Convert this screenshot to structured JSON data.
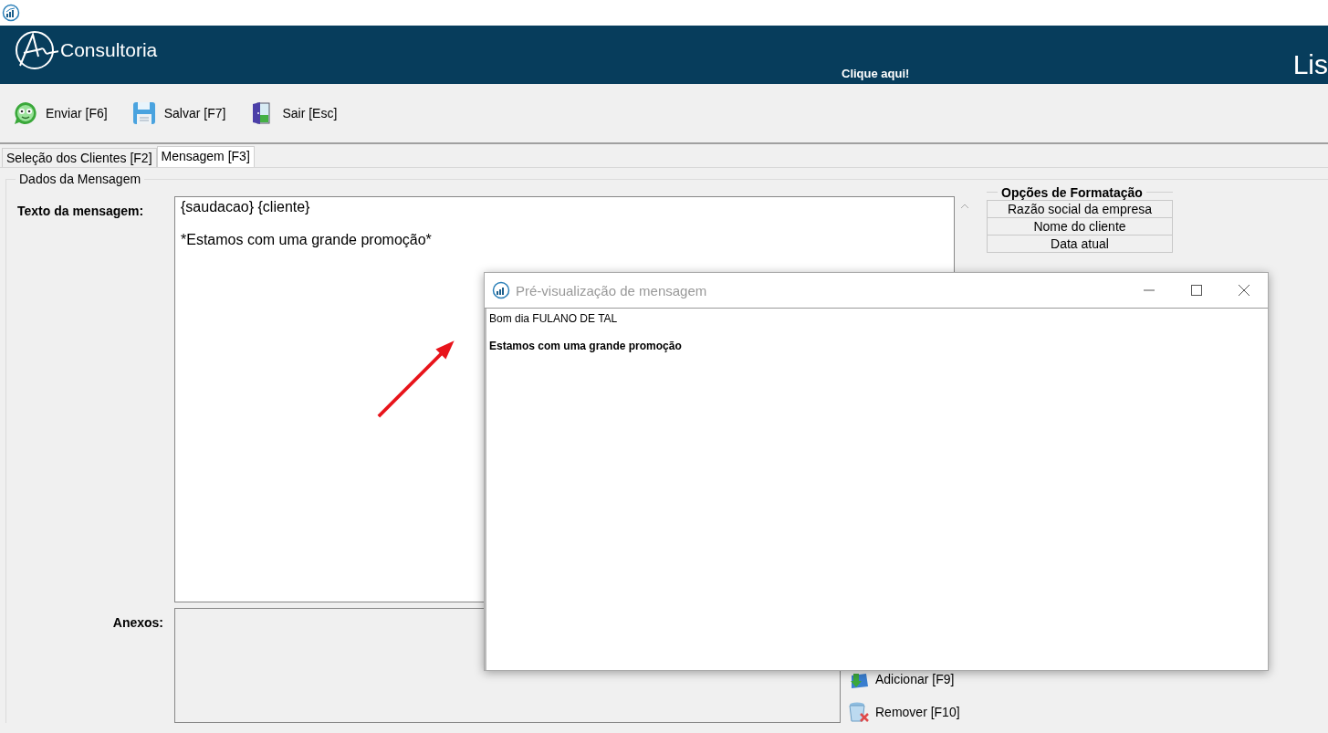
{
  "app_header": {
    "logo_text": "Consultoria",
    "link": "Clique aqui!",
    "title_fragment": "Lis"
  },
  "toolbar": [
    {
      "label": "Enviar [F6]",
      "kind": "send"
    },
    {
      "label": "Salvar [F7]",
      "kind": "save"
    },
    {
      "label": "Sair [Esc]",
      "kind": "exit"
    }
  ],
  "tabs": [
    {
      "label": "Seleção dos Clientes [F2]",
      "selected": false
    },
    {
      "label": "Mensagem [F3]",
      "selected": true
    }
  ],
  "group": {
    "title": "Dados da Mensagem",
    "message_label": "Texto da mensagem:",
    "message_value": "{saudacao} {cliente}\n\n*Estamos com uma grande promoção*"
  },
  "formatting": {
    "title": "Opções de Formatação",
    "options": [
      "Razão social da empresa",
      "Nome do cliente",
      "Data atual"
    ]
  },
  "attachments": {
    "label": "Anexos:",
    "buttons": [
      {
        "label": "Adicionar [F9]",
        "kind": "add"
      },
      {
        "label": "Remover [F10]",
        "kind": "remove"
      }
    ]
  },
  "preview_dialog": {
    "title": "Pré-visualização de mensagem",
    "lines": [
      {
        "text": "Bom dia FULANO DE TAL",
        "bold": false
      },
      {
        "text": "Estamos com uma grande promoção",
        "bold": true
      }
    ]
  }
}
